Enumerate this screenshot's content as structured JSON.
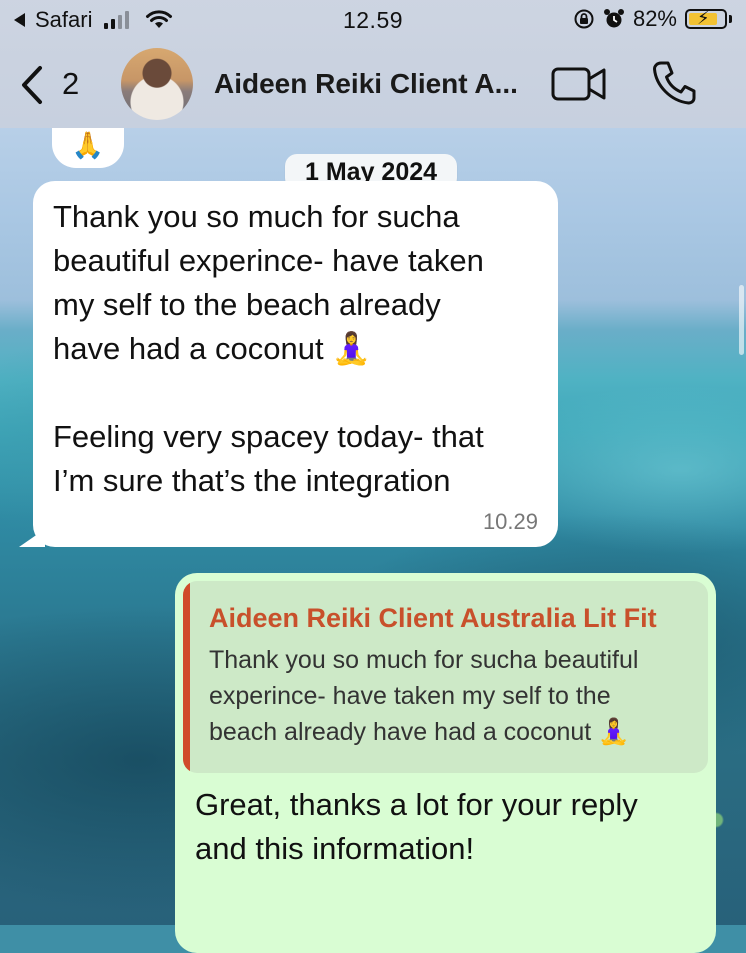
{
  "status_bar": {
    "back_app": "Safari",
    "time": "12.59",
    "battery_percent": "82%",
    "battery_level": 0.82,
    "signal_bars": 2
  },
  "header": {
    "back_count": "2",
    "chat_name": "Aideen Reiki Client A...",
    "icons": [
      "chevron-left-icon",
      "video-call-icon",
      "phone-icon"
    ]
  },
  "reaction": {
    "emoji": "🙏"
  },
  "date_chip": "1 May 2024",
  "messages": [
    {
      "direction": "incoming",
      "paragraphs": [
        [
          "Thank you so much for sucha",
          "beautiful experince- have taken",
          "my self to the beach already",
          "have had a coconut 🧘‍♀️"
        ],
        [
          "Feeling very spacey today- that",
          "I’m sure that’s the integration"
        ]
      ],
      "time": "10.29"
    },
    {
      "direction": "outgoing",
      "quote": {
        "author": "Aideen Reiki Client Australia Lit Fit",
        "text": [
          "Thank you so much for sucha beautiful",
          "experince- have taken my self to the",
          "beach already have had a coconut 🧘‍♀️"
        ]
      },
      "lines": [
        "Great, thanks a lot for your reply",
        "and this information!"
      ]
    }
  ],
  "colors": {
    "incoming_bubble": "#ffffff",
    "outgoing_bubble": "#d9fdd3",
    "quote_bar": "#d04b2a",
    "quote_author": "#c8502b"
  }
}
